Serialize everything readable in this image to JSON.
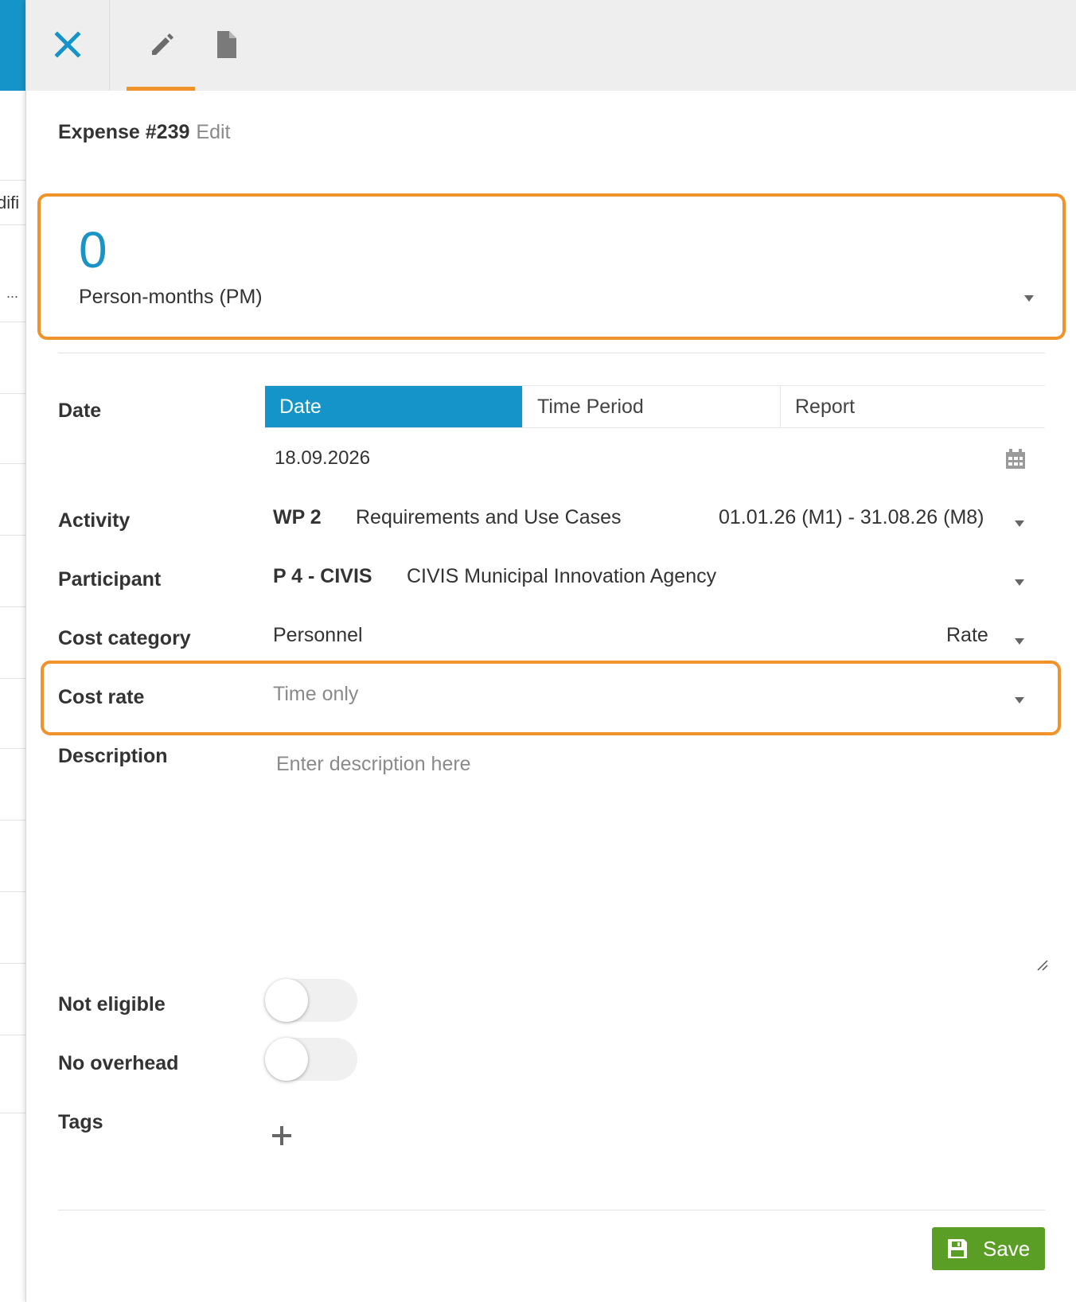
{
  "background": {
    "header_fragment": "difi",
    "row_fragment": "..."
  },
  "topbar": {
    "close_icon": "close-icon",
    "edit_icon": "pencil-icon",
    "doc_icon": "document-icon",
    "accent_color": "#f0932b"
  },
  "header": {
    "title": "Expense #239",
    "subtitle": "Edit"
  },
  "quantity": {
    "value": "0",
    "unit": "Person-months (PM)"
  },
  "form": {
    "date": {
      "label": "Date",
      "modes": [
        "Date",
        "Time Period",
        "Report"
      ],
      "active_mode": "Date",
      "value": "18.09.2026"
    },
    "activity": {
      "label": "Activity",
      "code": "WP 2",
      "name": "Requirements and Use Cases",
      "period": "01.01.26 (M1)  -  31.08.26 (M8)"
    },
    "participant": {
      "label": "Participant",
      "code": "P 4 - CIVIS",
      "name": "CIVIS Municipal Innovation Agency"
    },
    "cost_category": {
      "label": "Cost category",
      "value": "Personnel",
      "type": "Rate"
    },
    "cost_rate": {
      "label": "Cost rate",
      "value": "Time only"
    },
    "description": {
      "label": "Description",
      "placeholder": "Enter description here",
      "value": ""
    },
    "not_eligible": {
      "label": "Not eligible",
      "checked": false
    },
    "no_overhead": {
      "label": "No overhead",
      "checked": false
    },
    "tags": {
      "label": "Tags"
    }
  },
  "footer": {
    "save_label": "Save",
    "save_color": "#5a9e25"
  },
  "colors": {
    "primary": "#1494c8",
    "highlight": "#f0932b"
  }
}
